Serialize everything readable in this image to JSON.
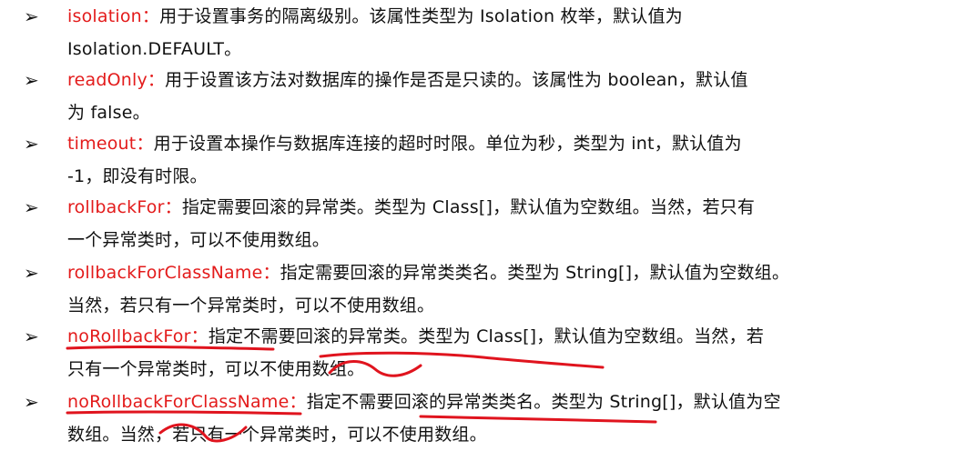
{
  "items": [
    {
      "bullet": "➢",
      "key": "isolation：",
      "line1": "用于设置事务的隔离级别。该属性类型为 Isolation 枚举，默认值为",
      "line2": "Isolation.DEFAULT。"
    },
    {
      "bullet": "➢",
      "key": "readOnly：",
      "line1": "用于设置该方法对数据库的操作是否是只读的。该属性为 boolean，默认值",
      "line2": "为 false。"
    },
    {
      "bullet": "➢",
      "key": "timeout：",
      "line1": "用于设置本操作与数据库连接的超时时限。单位为秒，类型为 int，默认值为",
      "line2": "-1，即没有时限。"
    },
    {
      "bullet": "➢",
      "key": "rollbackFor：",
      "line1": "指定需要回滚的异常类。类型为 Class[]，默认值为空数组。当然，若只有",
      "line2": "一个异常类时，可以不使用数组。"
    },
    {
      "bullet": "➢",
      "key": "rollbackForClassName：",
      "line1": "指定需要回滚的异常类类名。类型为 String[]，默认值为空数组。",
      "line2": "当然，若只有一个异常类时，可以不使用数组。"
    },
    {
      "bullet": "➢",
      "key": "noRollbackFor：",
      "line1": "指定不需要回滚的异常类。类型为 Class[]，默认值为空数组。当然，若",
      "line2": "只有一个异常类时，可以不使用数组。"
    },
    {
      "bullet": "➢",
      "key": "noRollbackForClassName：",
      "line1": "指定不需要回滚的异常类类名。类型为 String[]，默认值为空",
      "line2": "数组。当然，若只有一个异常类时，可以不使用数组。"
    }
  ],
  "colors": {
    "key_text": "#e31b1b",
    "body_text": "#111111",
    "annotation_ink": "#e0141e"
  }
}
